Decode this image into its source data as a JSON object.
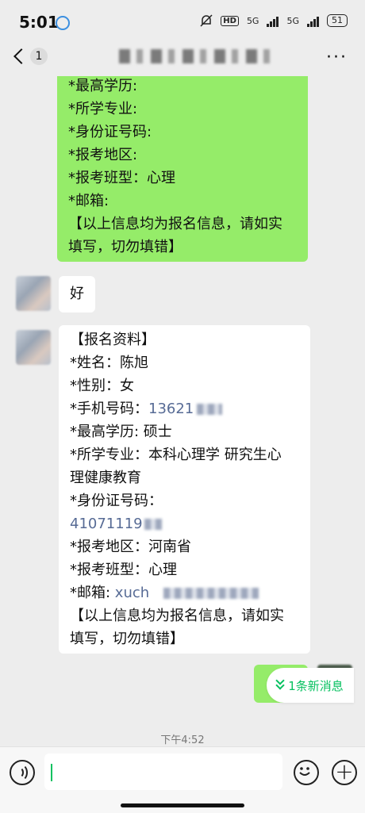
{
  "status_bar": {
    "time": "5:01",
    "hd": "HD",
    "net1": "5G",
    "net2": "5G",
    "battery": "51"
  },
  "header": {
    "back_count": "1",
    "more": "···"
  },
  "messages": {
    "sent_form_lines": [
      "*最高学历:",
      "*所学专业:",
      "*身份证号码:",
      "*报考地区:",
      "*报考班型：心理",
      "*邮箱:",
      "【以上信息均为报名信息，请如实",
      "填写，切勿填错】"
    ],
    "reply_ok": "好",
    "received_form": {
      "header": "【报名资料】",
      "name": "*姓名：陈旭",
      "gender": "*性别：女",
      "phone_label": "*手机号码：",
      "phone_value": "13621",
      "education": "*最高学历: 硕士",
      "major_line1": "*所学专业：本科心理学 研究生心",
      "major_line2": "理健康教育",
      "id_label": "*身份证号码：",
      "id_value": "41071119",
      "region": "*报考地区：河南省",
      "class_type": "*报考班型：心理",
      "email_label": "*邮箱: ",
      "email_value": "xuch",
      "footer1": "【以上信息均为报名信息，请如实",
      "footer2": "填写，切勿填错】"
    }
  },
  "time_divider": "下午4:52",
  "new_messages": "1条新消息",
  "colors": {
    "sent_bubble": "#95ec69",
    "link": "#576b95",
    "accent": "#07c160"
  }
}
